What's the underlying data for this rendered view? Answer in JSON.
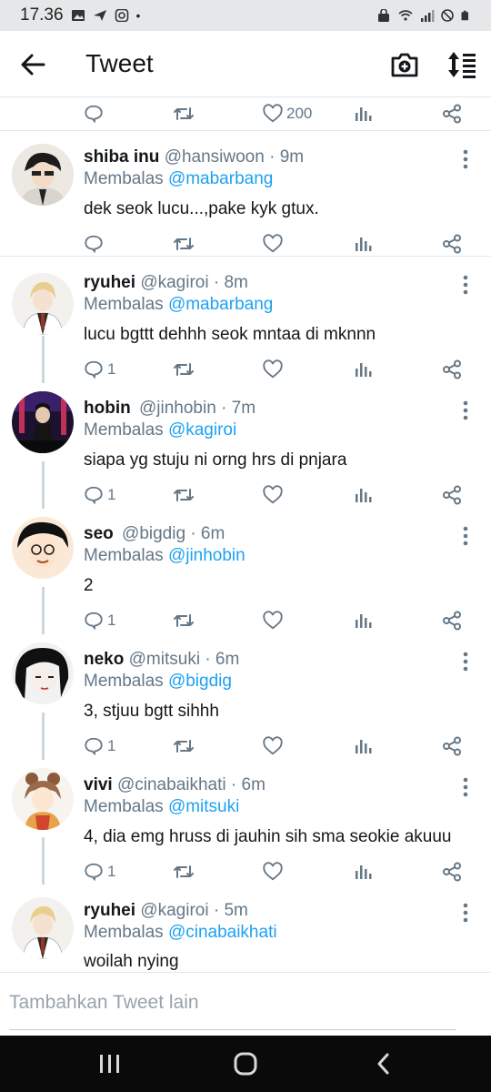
{
  "status_bar": {
    "time": "17.36",
    "dot": "•"
  },
  "app_bar": {
    "title": "Tweet"
  },
  "top_actions": {
    "likes": "200"
  },
  "tweets": [
    {
      "name": "shiba inu",
      "handle": "@hansiwoon",
      "time": "· 9m",
      "reply_prefix": "Membalas",
      "reply_to": "@mabarbang",
      "text": "dek seok lucu...,pake kyk gtux.",
      "replies": ""
    },
    {
      "name": "ryuhei",
      "handle": "@kagiroi",
      "time": "· 8m",
      "reply_prefix": "Membalas",
      "reply_to": "@mabarbang",
      "text": "lucu bgttt dehhh seok mntaa di mknnn",
      "replies": "1"
    },
    {
      "name": "hobin",
      "handle": "@jinhobin",
      "time": "· 7m",
      "reply_prefix": "Membalas",
      "reply_to": "@kagiroi",
      "text": "siapa yg stuju ni orng hrs di pnjara",
      "replies": "1"
    },
    {
      "name": "seo",
      "handle": "@bigdig",
      "time": "· 6m",
      "reply_prefix": "Membalas",
      "reply_to": "@jinhobin",
      "text": "2",
      "replies": "1"
    },
    {
      "name": "neko",
      "handle": "@mitsuki",
      "time": "· 6m",
      "reply_prefix": "Membalas",
      "reply_to": "@bigdig",
      "text": "3, stjuu bgtt sihhh",
      "replies": "1"
    },
    {
      "name": "vivi",
      "handle": "@cinabaikhati",
      "time": "· 6m",
      "reply_prefix": "Membalas",
      "reply_to": "@mitsuki",
      "text": "4, dia emg hruss di jauhin sih sma seokie akuuu",
      "replies": "1"
    },
    {
      "name": "ryuhei",
      "handle": "@kagiroi",
      "time": "· 5m",
      "reply_prefix": "Membalas",
      "reply_to": "@cinabaikhati",
      "text": "woilah nying",
      "replies": ""
    }
  ],
  "compose": {
    "placeholder": "Tambahkan Tweet lain"
  },
  "colors": {
    "accent": "#1da1f2",
    "muted": "#657786",
    "text": "#14171a",
    "nav_bg": "#0a0a0a",
    "status_bg": "#e6e7e8"
  }
}
